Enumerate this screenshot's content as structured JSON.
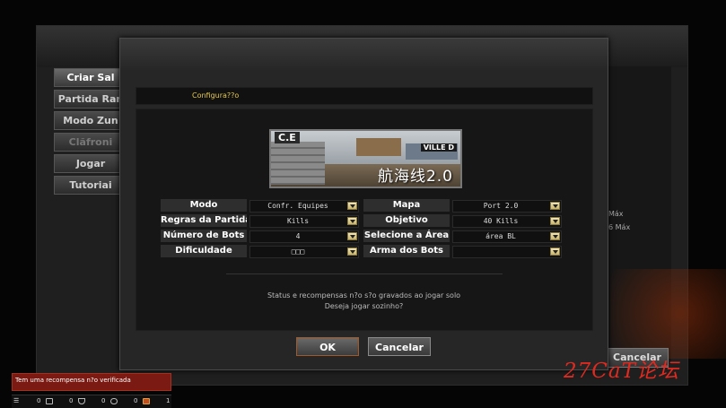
{
  "background": {
    "side_menu": [
      "Criar Sal",
      "Partida Ran",
      "Modo Zun",
      "Clãfroni",
      "Jogar",
      "Tutoriai"
    ],
    "right_texts": [
      "Máx",
      "6 Máx"
    ],
    "cancel_label": "Cancelar"
  },
  "dialog": {
    "title": "Configura??o",
    "map": {
      "tag": "C.E",
      "sign": "VILLE D",
      "chinese_name": "航海线2.0"
    },
    "options": [
      {
        "label": "Modo",
        "value": "Confr. Equipes"
      },
      {
        "label": "Regras da Partida",
        "value": "Kills"
      },
      {
        "label": "Número de Bots",
        "value": "4"
      },
      {
        "label": "Dificuldade",
        "value": "□□□"
      },
      {
        "label": "Mapa",
        "value": "Port 2.0"
      },
      {
        "label": "Objetivo",
        "value": "40 Kills"
      },
      {
        "label": "Selecione a Área",
        "value": "área BL"
      },
      {
        "label": "Arma dos Bots",
        "value": ""
      }
    ],
    "message_line1": "Status e recompensas n?o s?o gravados ao jogar solo",
    "message_line2": "Deseja jogar sozinho?",
    "ok_label": "OK",
    "cancel_label": "Cancelar"
  },
  "notification": "Tem uma recompensa n?o verificada",
  "status_bar": {
    "counts": [
      "0",
      "0",
      "0",
      "0",
      "1"
    ]
  },
  "watermark": "27CaT论坛"
}
